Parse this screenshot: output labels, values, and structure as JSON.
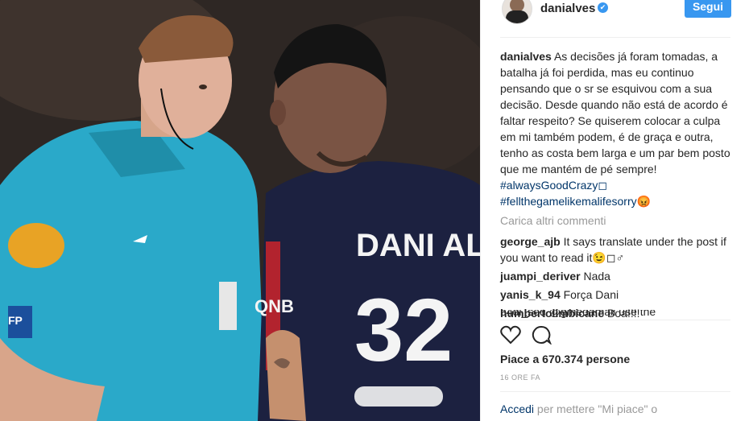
{
  "photo": {
    "jersey_name": "DANI ALVES",
    "jersey_number": "32",
    "sponsor": "QNB",
    "badge_text": "FP"
  },
  "header": {
    "username": "danialves",
    "verified_icon": "✔",
    "follow_label": "Segui"
  },
  "caption": {
    "username": "danialves",
    "text": "As decisões já foram tomadas, a batalha já foi perdida, mas eu continuo pensando que o sr se esquivou com a sua decisão. Desde quando não está de acordo é faltar respeito? Se quiserem colocar a culpa em mi também podem, é de graça e outra, tenho as costa bem larga e um par bem posto que me mantém de pé sempre!",
    "hashtag1": "#alwaysGoodCrazy◻",
    "hashtag2": "#fellthegamelikemalifesorry😡"
  },
  "load_more": "Carica altri commenti",
  "comments": [
    {
      "user": "george_ajb",
      "text": "It says translate under the post if you want to read it😉◻♂"
    },
    {
      "user": "juampi_deriver",
      "text": "Nada"
    },
    {
      "user": "yanis_k_94",
      "text": "Força Dani"
    },
    {
      "user": "humbertolimbicane",
      "text": "Boa!!!!"
    }
  ],
  "cut_comment": "b4di_sed @gmedamail use the",
  "likes": "Piace a 670.374 persone",
  "time": "16 ORE FA",
  "login": {
    "link": "Accedi",
    "text": " per mettere \"Mi piace\" o"
  },
  "colors": {
    "accent": "#3897f0",
    "hashtag": "#003569",
    "muted": "#999999",
    "referee_shirt": "#2aa9c9",
    "psg_shirt": "#1c2140"
  },
  "icons": [
    "heart-icon",
    "comment-icon",
    "verified-icon"
  ]
}
